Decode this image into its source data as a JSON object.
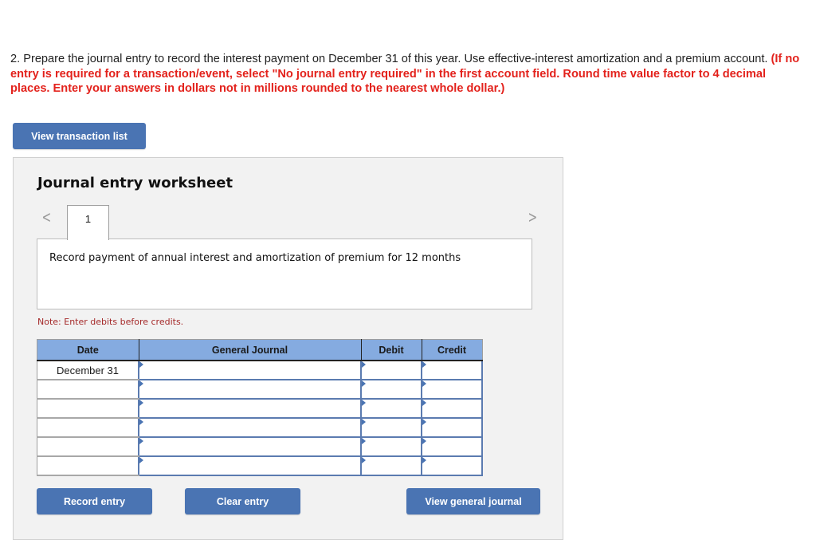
{
  "question": {
    "text": "2. Prepare the journal entry to record the interest payment on December 31 of this year. Use effective-interest amortization and a premium account. ",
    "instructions": "(If no entry is required for a transaction/event, select \"No journal entry required\" in the first account field. Round time value factor to 4 decimal places. Enter your answers in dollars not in millions rounded to the nearest whole dollar.)"
  },
  "buttons": {
    "view_transaction_list": "View transaction list",
    "record_entry": "Record entry",
    "clear_entry": "Clear entry",
    "view_general_journal": "View general journal"
  },
  "worksheet": {
    "title": "Journal entry worksheet",
    "prev_icon": "chevron-left-icon",
    "next_icon": "chevron-right-icon",
    "prev_glyph": "<",
    "next_glyph": ">",
    "tabs": [
      {
        "label": "1",
        "active": true
      }
    ],
    "description": "Record payment of annual interest and amortization of premium for 12 months",
    "note": "Note: Enter debits before credits."
  },
  "table": {
    "headers": [
      "Date",
      "General Journal",
      "Debit",
      "Credit"
    ],
    "rows": [
      {
        "date": "December 31",
        "account": "",
        "debit": "",
        "credit": ""
      },
      {
        "date": "",
        "account": "",
        "debit": "",
        "credit": ""
      },
      {
        "date": "",
        "account": "",
        "debit": "",
        "credit": ""
      },
      {
        "date": "",
        "account": "",
        "debit": "",
        "credit": ""
      },
      {
        "date": "",
        "account": "",
        "debit": "",
        "credit": ""
      },
      {
        "date": "",
        "account": "",
        "debit": "",
        "credit": ""
      }
    ]
  },
  "colors": {
    "accent_button": "#4a74b3",
    "header_blue": "#85abe0",
    "instruction_red": "#e3221c",
    "note_red": "#a52a2a"
  }
}
